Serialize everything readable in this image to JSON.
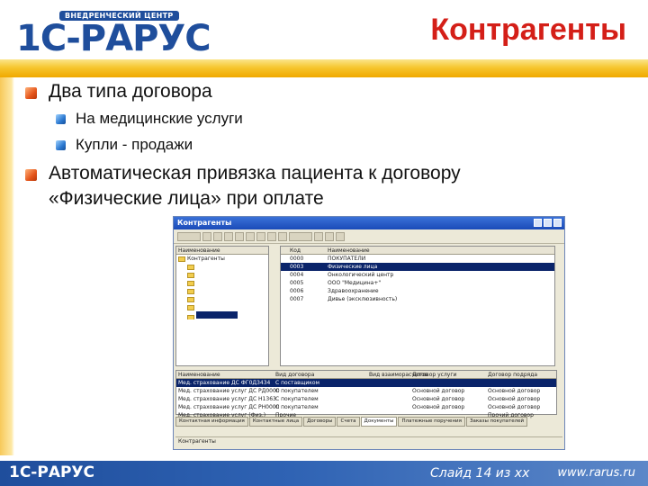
{
  "header": {
    "logo_text": "1С-РАРУС",
    "logo_subtitle": "ВНЕДРЕНЧЕСКИЙ ЦЕНТР",
    "title": "Контрагенты"
  },
  "bullets": [
    {
      "text": "Два типа договора",
      "sub": [
        "На медицинские услуги",
        "Купли - продажи"
      ]
    },
    {
      "line1": "Автоматическая привязка пациента к договору",
      "line2": "«Физические лица» при оплате"
    }
  ],
  "app": {
    "window_title": "Контрагенты",
    "tree_header": "Наименование",
    "tree_root": "Контрагенты",
    "list_headers": {
      "code": "Код",
      "name": "Наименование"
    },
    "list_rows": [
      {
        "code": "0000",
        "name": "ПОКУПАТЕЛИ"
      },
      {
        "code": "0003",
        "name": "Физические лица"
      },
      {
        "code": "0004",
        "name": "Онкологический центр"
      },
      {
        "code": "0005",
        "name": "ООО \"Медицина+\""
      },
      {
        "code": "0006",
        "name": "Здравоохранение"
      },
      {
        "code": "0007",
        "name": "Дивье (эксклюзивность)"
      }
    ],
    "lower_headers": [
      "Наименование",
      "Вид договора",
      "Вид взаиморасчетов",
      "Договор услуги",
      "Договор подряда"
    ],
    "lower_rows": [
      [
        "Мед. страхование ДС ФГ0Д3434",
        "С поставщиком",
        "",
        "",
        ""
      ],
      [
        "Мед. страхование услуг ДС РД0000",
        "С покупателем",
        "",
        "Основной договор",
        "Основной договор"
      ],
      [
        "Мед. страхование услуг ДС Н1363",
        "С покупателем",
        "",
        "Основной договор",
        "Основной договор"
      ],
      [
        "Мед. страхование услуг ДС РН0000",
        "С покупателем",
        "",
        "Основной договор",
        "Основной договор"
      ],
      [
        "Мед. страхование услуг (Физ.)",
        "Прочие",
        "",
        "",
        "Прочий договор"
      ]
    ],
    "tabs": [
      "Контактная информация",
      "Контактные лица",
      "Договоры",
      "Счета",
      "Документы",
      "Платежные поручения",
      "Заказы покупателей"
    ],
    "status_text": "Контрагенты"
  },
  "footer": {
    "logo_text": "1С-РАРУС",
    "slide_label": "Слайд 14 из хх",
    "site": "www.rarus.ru"
  },
  "colors": {
    "title": "#d41f18",
    "brand_blue": "#1f4e9c",
    "stripe": "#f6c62f"
  }
}
